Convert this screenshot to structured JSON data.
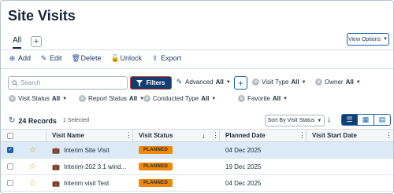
{
  "page": {
    "title": "Site Visits"
  },
  "tabs": {
    "all": "All",
    "add": "+"
  },
  "view_options": {
    "label": "View Options"
  },
  "toolbar": {
    "add": "Add",
    "edit": "Edit",
    "delete": "Delete",
    "unlock": "Unlock",
    "export": "Export"
  },
  "filters": {
    "search_placeholder": "Search",
    "filters_button": "Filters",
    "advanced": "Advanced",
    "advanced_value": "All",
    "chips": [
      {
        "label": "Visit Type",
        "value": "All"
      },
      {
        "label": "Owner",
        "value": "All"
      },
      {
        "label": "Visit Status",
        "value": "All"
      },
      {
        "label": "Report Status",
        "value": "All"
      },
      {
        "label": "Conducted Type",
        "value": "All"
      },
      {
        "label": "Favorite",
        "value": "All"
      }
    ]
  },
  "records": {
    "count": "24 Records",
    "selected": "1 Selected",
    "sort_by": "Sort By Visit Status"
  },
  "table": {
    "columns": [
      "Visit Name",
      "Visit Status",
      "Planned Date",
      "Visit Start Date"
    ],
    "rows": [
      {
        "name": "Interim Site Visit",
        "status": "PLANNED",
        "planned": "04 Dec 2025",
        "start": "",
        "selected": true
      },
      {
        "name": "Interim-202 3.1 wind...",
        "status": "PLANNED",
        "planned": "19 Dec 2025",
        "start": "",
        "selected": false
      },
      {
        "name": "Interim visit Test",
        "status": "PLANNED",
        "planned": "04 Dec 2025",
        "start": "",
        "selected": false
      }
    ]
  },
  "colors": {
    "primary": "#123f73",
    "accent": "#1f5fa8",
    "badge": "#f0880a",
    "selected_row": "#dce9f7"
  },
  "icons": {
    "refresh": "refresh-icon",
    "star": "star-icon",
    "briefcase": "briefcase-icon",
    "filter": "funnel-icon"
  }
}
